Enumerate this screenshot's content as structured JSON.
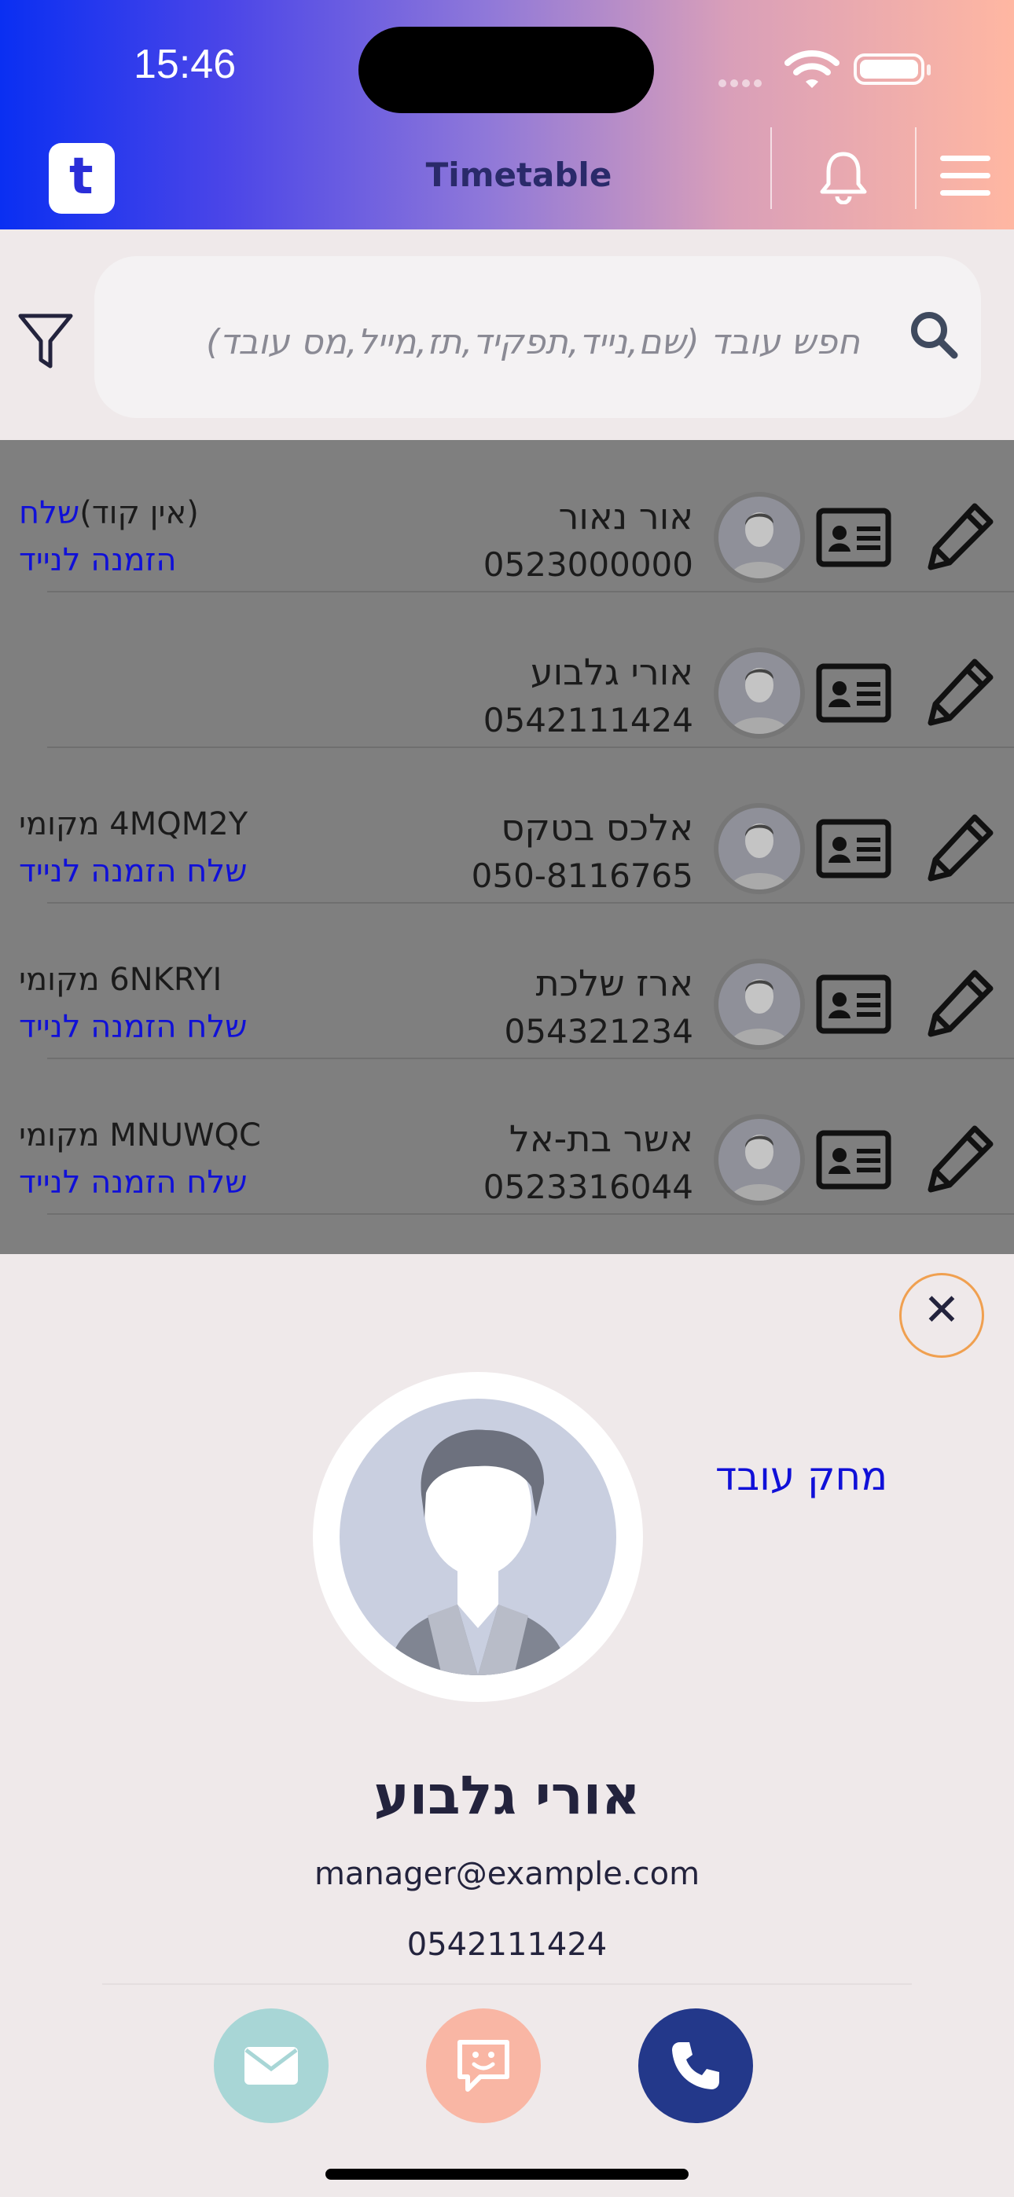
{
  "status_bar": {
    "time": "15:46"
  },
  "header": {
    "title": "Timetable",
    "logo_letter": "t"
  },
  "search": {
    "placeholder": "חפש עובד (שם,נייד,תפקיד,תז,מייל,מס עובד)"
  },
  "employees": [
    {
      "name": "אור נאור",
      "phone": "0523000000",
      "code_prefix": "(אין קוד)",
      "code_action": "שלח",
      "invite": "הזמנה לנייד"
    },
    {
      "name": "אורי גלבוע",
      "phone": "0542111424",
      "code_prefix": "",
      "code_action": "",
      "invite": ""
    },
    {
      "name": "אלכס בטקס",
      "phone": "050-8116765",
      "code_prefix": "4MQM2Y מקומי",
      "code_action": "",
      "invite": "שלח הזמנה לנייד"
    },
    {
      "name": "ארז שלכת",
      "phone": "054321234",
      "code_prefix": "6NKRYI מקומי",
      "code_action": "",
      "invite": "שלח הזמנה לנייד"
    },
    {
      "name": "אשר בת-אל",
      "phone": "0523316044",
      "code_prefix": "MNUWQC מקומי",
      "code_action": "",
      "invite": "שלח הזמנה לנייד"
    }
  ],
  "sheet": {
    "delete_label": "מחק עובד",
    "name": "אורי גלבוע",
    "email": "manager@example.com",
    "phone": "0542111424"
  },
  "colors": {
    "accent_blue": "#1010d8",
    "call": "#23388a",
    "mail": "#a8d6d6",
    "chat": "#f9b6a4"
  }
}
